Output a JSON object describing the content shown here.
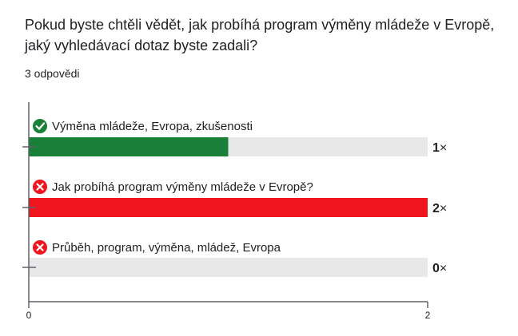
{
  "question": {
    "text": "Pokud byste chtěli vědět, jak probíhá program výměny mládeže v Evropě, jaký vyhledávací dotaz byste zadali?"
  },
  "responses": {
    "count_text": "3 odpovědi"
  },
  "colors": {
    "correct": "#188038",
    "incorrect": "#f0141e",
    "track": "#e8e8e8",
    "axis": "#5f6368"
  },
  "chart_data": {
    "type": "bar",
    "orientation": "horizontal",
    "categories": [
      "Výměna mládeže, Evropa, zkušenosti",
      "Jak probíhá program výměny mládeže v Evropě?",
      "Průběh, program, výměna, mládež, Evropa"
    ],
    "values": [
      1,
      2,
      0
    ],
    "status": [
      "correct",
      "incorrect",
      "incorrect"
    ],
    "status_icons": [
      "check-circle-icon",
      "cross-circle-icon",
      "cross-circle-icon"
    ],
    "value_suffix": "×",
    "xlim": [
      0,
      2
    ],
    "xticks": [
      "0",
      "2"
    ],
    "grid": false
  }
}
